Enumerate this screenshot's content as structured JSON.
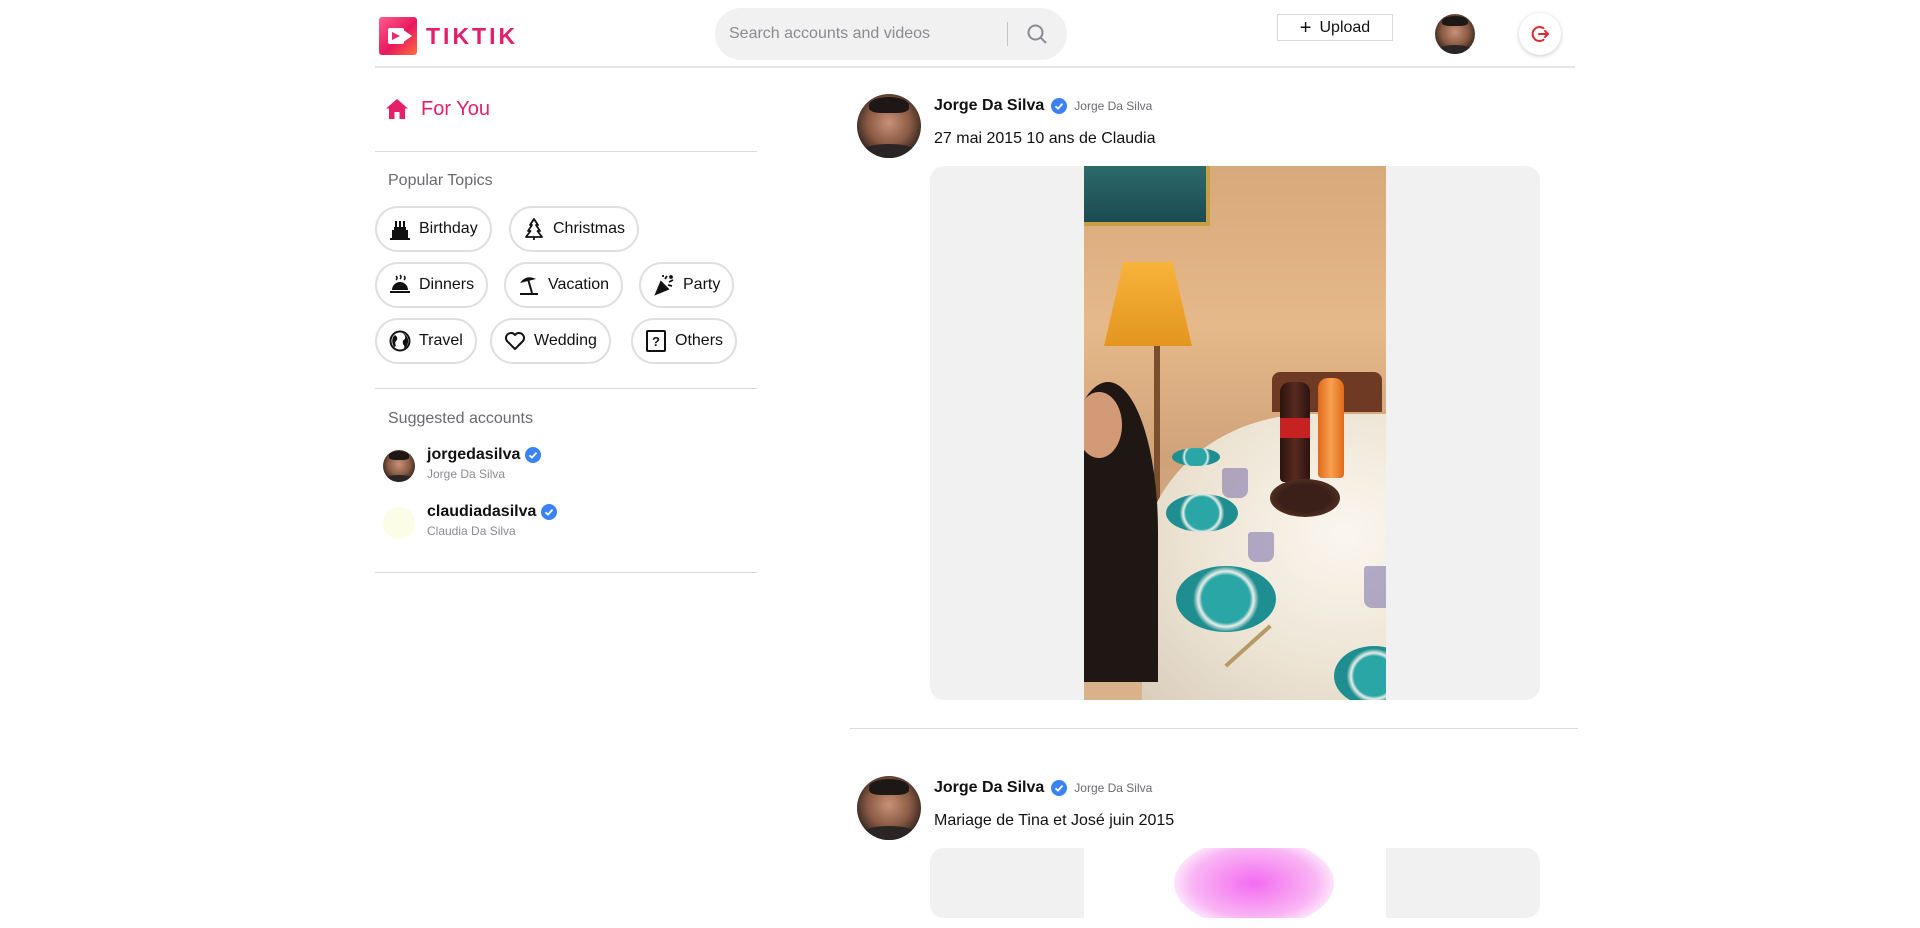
{
  "header": {
    "logo_text": "TIKTIK",
    "search": {
      "placeholder": "Search accounts and videos"
    },
    "upload_label": "Upload",
    "accent_color": "#e5206a"
  },
  "sidebar": {
    "for_you_label": "For You",
    "popular_topics_title": "Popular Topics",
    "topics": [
      {
        "label": "Birthday",
        "icon": "birthday-cake-icon"
      },
      {
        "label": "Christmas",
        "icon": "christmas-tree-icon"
      },
      {
        "label": "Dinners",
        "icon": "dinner-cloche-icon"
      },
      {
        "label": "Vacation",
        "icon": "beach-umbrella-icon"
      },
      {
        "label": "Party",
        "icon": "party-popper-icon"
      },
      {
        "label": "Travel",
        "icon": "globe-icon"
      },
      {
        "label": "Wedding",
        "icon": "heart-icon"
      },
      {
        "label": "Others",
        "icon": "question-box-icon"
      }
    ],
    "suggested_title": "Suggested accounts",
    "accounts": [
      {
        "username": "jorgedasilva",
        "full_name": "Jorge Da Silva"
      },
      {
        "username": "claudiadasilva",
        "full_name": "Claudia Da Silva"
      }
    ]
  },
  "feed": {
    "posts": [
      {
        "author": "Jorge Da Silva",
        "handle": "Jorge Da Silva",
        "caption": "27 mai 2015 10 ans de Claudia"
      },
      {
        "author": "Jorge Da Silva",
        "handle": "Jorge Da Silva",
        "caption": "Mariage de Tina et José juin 2015"
      }
    ]
  }
}
